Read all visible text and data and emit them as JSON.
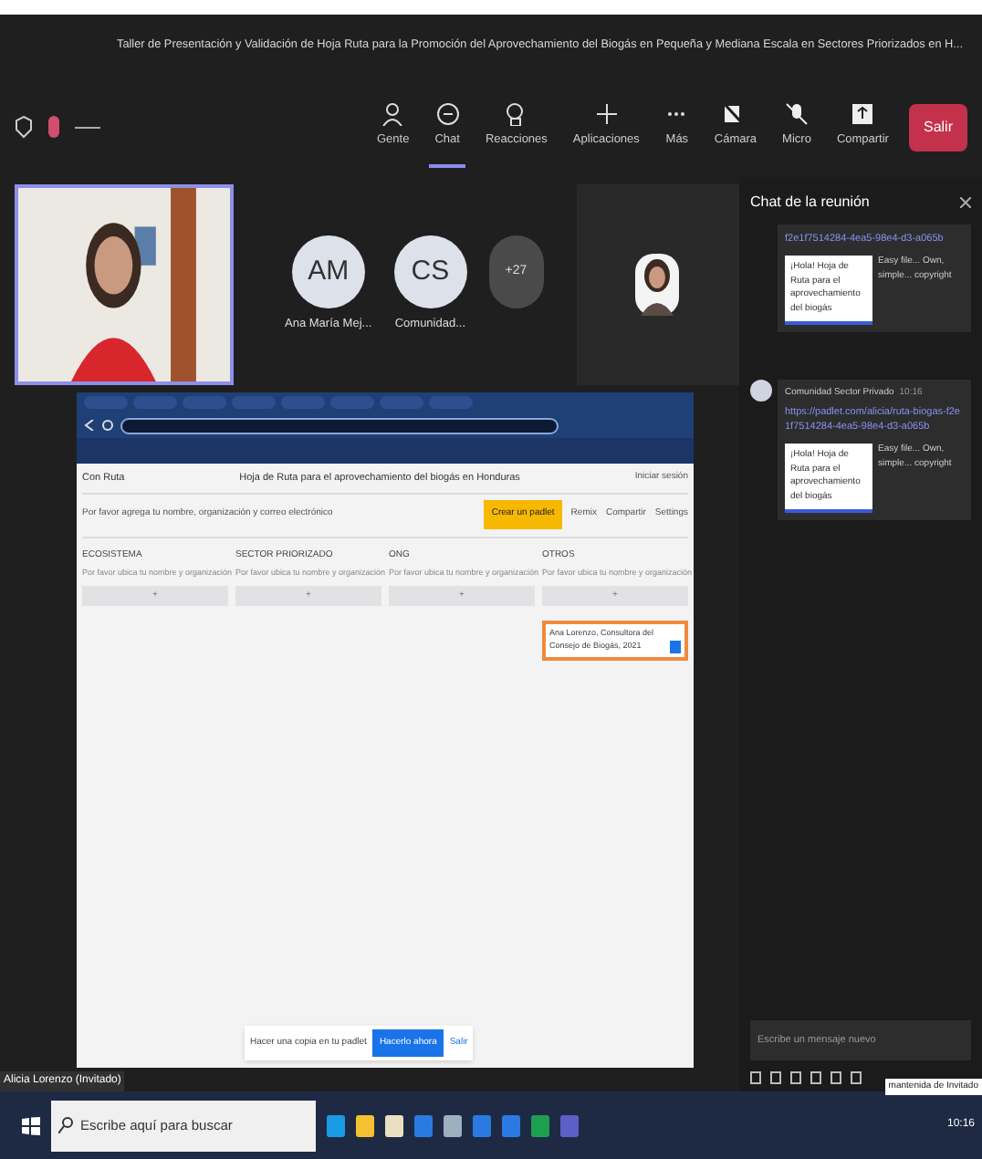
{
  "window": {
    "title": "Taller de Presentación y Validación de Hoja Ruta para la Promoción del Aprovechamiento del Biogás en Pequeña y Mediana Escala en Sectores Priorizados en H..."
  },
  "toolbar": {
    "buttons": [
      {
        "label": "Gente",
        "selected": false,
        "kind": "people"
      },
      {
        "label": "Chat",
        "selected": true,
        "kind": "chat"
      },
      {
        "label": "Reacciones",
        "selected": false,
        "kind": "react"
      },
      {
        "label": "Aplicaciones",
        "selected": false,
        "kind": "apps"
      },
      {
        "label": "Más",
        "selected": false,
        "kind": "more"
      },
      {
        "label": "Cámara",
        "selected": false,
        "kind": "camera"
      },
      {
        "label": "Micro",
        "selected": false,
        "kind": "mic"
      },
      {
        "label": "Compartir",
        "selected": false,
        "kind": "share"
      }
    ],
    "leave": "Salir"
  },
  "presenter": {
    "kind": "picture",
    "name": "Alicia Lorenzo (Invitado)"
  },
  "participants": [
    {
      "kind": "avatar",
      "initials": "AM",
      "name": "Ana María Mej..."
    },
    {
      "kind": "avatar",
      "initials": "CS",
      "name": "Comunidad..."
    },
    {
      "kind": "overflow",
      "initials": "+27"
    }
  ],
  "shared_screen": {
    "logo": "Con Ruta",
    "title": "Hoja de Ruta para el aprovechamiento del biogás en Honduras",
    "login": "Iniciar sesión",
    "subtitle": "Por favor agrega tu nombre, organización y correo electrónico",
    "actions": [
      {
        "label": "Crear un padlet",
        "kind": "primary"
      },
      {
        "label": "Remix",
        "kind": "plain"
      },
      {
        "label": "Compartir",
        "kind": "plain"
      },
      {
        "label": "Settings",
        "kind": "plain"
      }
    ],
    "columns": [
      {
        "heading": "ECOSISTEMA",
        "description": "Por favor ubica tu nombre y organización",
        "add": "+"
      },
      {
        "heading": "SECTOR PRIORIZADO",
        "description": "Por favor ubica tu nombre y organización",
        "add": "+"
      },
      {
        "heading": "ONG",
        "description": "Por favor ubica tu nombre y organización",
        "add": "+"
      },
      {
        "heading": "OTROS",
        "description": "Por favor ubica tu nombre y organización",
        "add": "+"
      }
    ],
    "post": "Ana Lorenzo, Consultora del Consejo de Biogás, 2021",
    "banner": {
      "text": "Hacer una copia en tu padlet",
      "button": "Hacerlo ahora",
      "link": "Salir"
    }
  },
  "chat": {
    "title": "Chat de la reunión",
    "messages": [
      {
        "link": "f2e1f7514284-4ea5-98e4-d3-a065b",
        "preview_title": "¡Hola! Hoja de Ruta para el aprovechamiento del biogás",
        "preview_side": "Easy file... Own, simple... copyright"
      },
      {
        "sender": "Comunidad Sector Privado",
        "time": "10:16",
        "link": "https://padlet.com/alicia/ruta-biogas-f2e1f7514284-4ea5-98e4-d3-a065b",
        "preview_title": "¡Hola! Hoja de Ruta para el aprovechamiento del biogás",
        "preview_side": "Easy file... Own, simple... copyright"
      }
    ],
    "placeholder": "Escribe un mensaje nuevo",
    "tooltip": "mantenida de Invitado"
  },
  "taskbar": {
    "placeholder": "Escribe aquí para buscar",
    "time": "10:16"
  }
}
